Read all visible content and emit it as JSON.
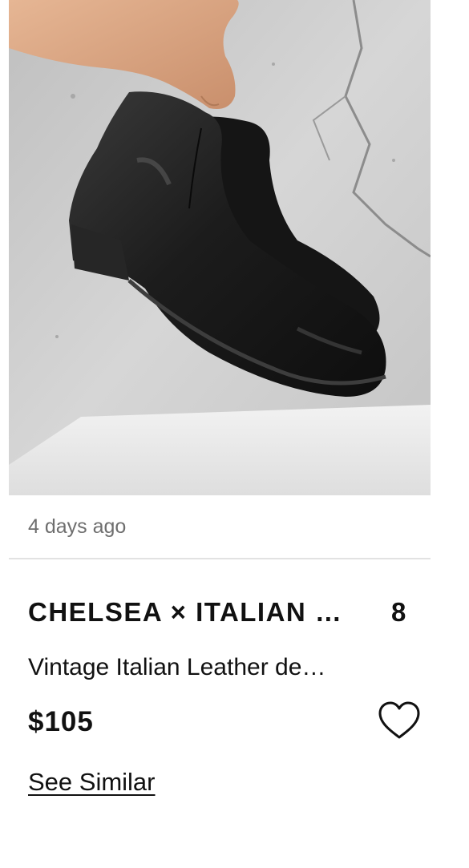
{
  "listing": {
    "posted_ago": "4 days ago",
    "designer": "CHELSEA × ITALIAN …",
    "size": "8",
    "title": "Vintage Italian Leather de…",
    "price": "$105",
    "see_similar_label": "See Similar",
    "photo_subject": "black leather ankle boots held by hand",
    "favorite_icon": "heart-outline-icon"
  },
  "colors": {
    "text": "#111111",
    "muted": "#6e6e6e",
    "divider": "#e2e2e2",
    "background": "#ffffff"
  }
}
